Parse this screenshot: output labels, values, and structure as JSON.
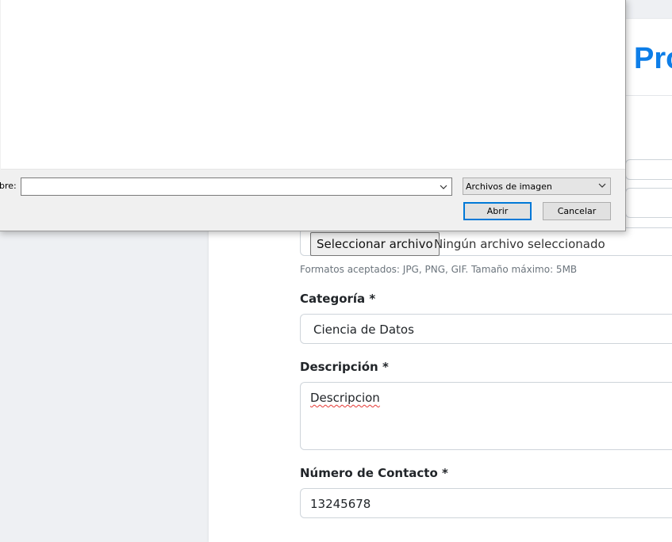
{
  "page": {
    "title_partial": "Pro"
  },
  "form": {
    "image": {
      "button_label": "Seleccionar archivo",
      "status": "Ningún archivo seleccionado",
      "help": "Formatos aceptados: JPG, PNG, GIF. Tamaño máximo: 5MB"
    },
    "category": {
      "label": "Categoría *",
      "value": "Ciencia de Datos"
    },
    "description": {
      "label": "Descripción *",
      "value": "Descripcion"
    },
    "contact": {
      "label": "Número de Contacto *",
      "value": "13245678"
    }
  },
  "dialog": {
    "name_label_partial": "bre:",
    "filename_value": "",
    "filetype": "Archivos de imagen",
    "open_label": "Abrir",
    "cancel_label": "Cancelar",
    "icons": {
      "name_dropdown": "chevron-down-icon",
      "type_dropdown": "chevron-down-icon"
    }
  }
}
